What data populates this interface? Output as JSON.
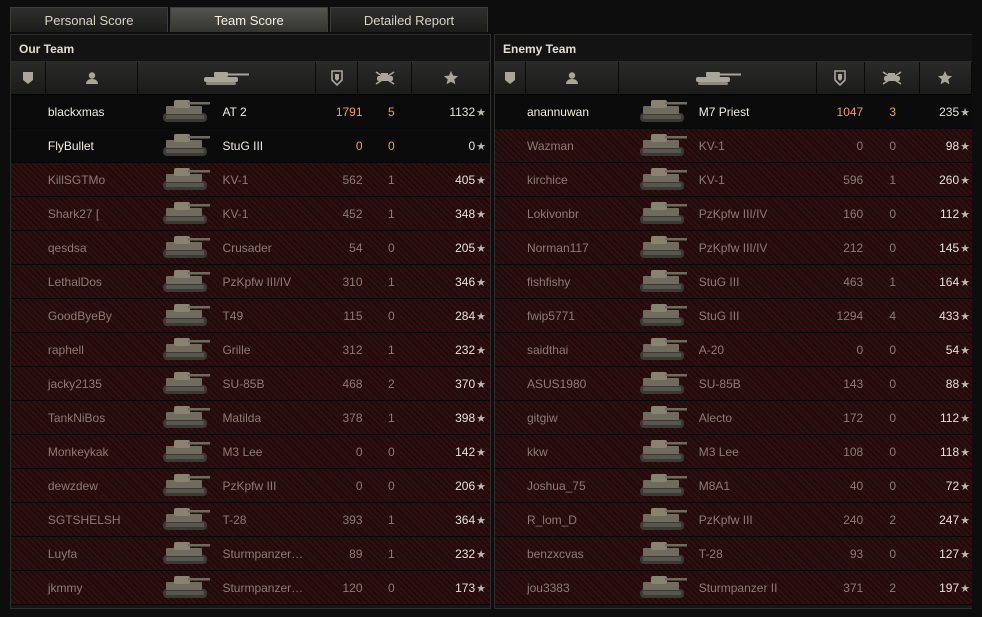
{
  "tabs": [
    {
      "label": "Personal Score",
      "active": false
    },
    {
      "label": "Team Score",
      "active": true
    },
    {
      "label": "Detailed Report",
      "active": false
    }
  ],
  "columns_icons": [
    "platoon-icon",
    "player-icon",
    "tank-icon",
    "damage-shield-icon",
    "kills-icon",
    "xp-star-icon"
  ],
  "colors": {
    "accent_orange": "#f2a13c",
    "dead_row": "#2a0c0c",
    "alive_row": "#0b0b0b"
  },
  "our_team": {
    "title": "Our Team",
    "players": [
      {
        "name": "blackxmas",
        "tank": "AT 2",
        "damage": "1791",
        "kills": "5",
        "xp": "1132",
        "alive": true
      },
      {
        "name": "FlyBullet",
        "tank": "StuG III",
        "damage": "0",
        "kills": "0",
        "xp": "0",
        "alive": true
      },
      {
        "name": "KillSGTMo",
        "tank": "KV-1",
        "damage": "562",
        "kills": "1",
        "xp": "405",
        "alive": false
      },
      {
        "name": "Shark27 [",
        "tank": "KV-1",
        "damage": "452",
        "kills": "1",
        "xp": "348",
        "alive": false
      },
      {
        "name": "qesdsa",
        "tank": "Crusader",
        "damage": "54",
        "kills": "0",
        "xp": "205",
        "alive": false
      },
      {
        "name": "LethalDos",
        "tank": "PzKpfw III/IV",
        "damage": "310",
        "kills": "1",
        "xp": "346",
        "alive": false
      },
      {
        "name": "GoodByeBy",
        "tank": "T49",
        "damage": "115",
        "kills": "0",
        "xp": "284",
        "alive": false
      },
      {
        "name": "raphell",
        "tank": "Grille",
        "damage": "312",
        "kills": "1",
        "xp": "232",
        "alive": false
      },
      {
        "name": "jacky2135",
        "tank": "SU-85B",
        "damage": "468",
        "kills": "2",
        "xp": "370",
        "alive": false
      },
      {
        "name": "TankNiBos",
        "tank": "Matilda",
        "damage": "378",
        "kills": "1",
        "xp": "398",
        "alive": false
      },
      {
        "name": "Monkeykak",
        "tank": "M3 Lee",
        "damage": "0",
        "kills": "0",
        "xp": "142",
        "alive": false
      },
      {
        "name": "dewzdew",
        "tank": "PzKpfw III",
        "damage": "0",
        "kills": "0",
        "xp": "206",
        "alive": false
      },
      {
        "name": "SGTSHELSH",
        "tank": "T-28",
        "damage": "393",
        "kills": "1",
        "xp": "364",
        "alive": false
      },
      {
        "name": "Luyfa",
        "tank": "Sturmpanzer…",
        "damage": "89",
        "kills": "1",
        "xp": "232",
        "alive": false
      },
      {
        "name": "jkmmy",
        "tank": "Sturmpanzer…",
        "damage": "120",
        "kills": "0",
        "xp": "173",
        "alive": false
      }
    ]
  },
  "enemy_team": {
    "title": "Enemy Team",
    "players": [
      {
        "name": "anannuwan",
        "tank": "M7 Priest",
        "damage": "1047",
        "kills": "3",
        "xp": "235",
        "alive": true
      },
      {
        "name": "Wazman",
        "tank": "KV-1",
        "damage": "0",
        "kills": "0",
        "xp": "98",
        "alive": false
      },
      {
        "name": "kirchice",
        "tank": "KV-1",
        "damage": "596",
        "kills": "1",
        "xp": "260",
        "alive": false
      },
      {
        "name": "Lokivonbr",
        "tank": "PzKpfw III/IV",
        "damage": "160",
        "kills": "0",
        "xp": "112",
        "alive": false
      },
      {
        "name": "Norman117",
        "tank": "PzKpfw III/IV",
        "damage": "212",
        "kills": "0",
        "xp": "145",
        "alive": false
      },
      {
        "name": "fishfishy",
        "tank": "StuG III",
        "damage": "463",
        "kills": "1",
        "xp": "164",
        "alive": false
      },
      {
        "name": "fwip5771",
        "tank": "StuG III",
        "damage": "1294",
        "kills": "4",
        "xp": "433",
        "alive": false
      },
      {
        "name": "saidthai",
        "tank": "A-20",
        "damage": "0",
        "kills": "0",
        "xp": "54",
        "alive": false
      },
      {
        "name": "ASUS1980",
        "tank": "SU-85B",
        "damage": "143",
        "kills": "0",
        "xp": "88",
        "alive": false
      },
      {
        "name": "gitgiw",
        "tank": "Alecto",
        "damage": "172",
        "kills": "0",
        "xp": "112",
        "alive": false
      },
      {
        "name": "kkw",
        "tank": "M3 Lee",
        "damage": "108",
        "kills": "0",
        "xp": "118",
        "alive": false
      },
      {
        "name": "Joshua_75",
        "tank": "M8A1",
        "damage": "40",
        "kills": "0",
        "xp": "72",
        "alive": false
      },
      {
        "name": "R_lom_D",
        "tank": "PzKpfw III",
        "damage": "240",
        "kills": "2",
        "xp": "247",
        "alive": false
      },
      {
        "name": "benzxcvas",
        "tank": "T-28",
        "damage": "93",
        "kills": "0",
        "xp": "127",
        "alive": false
      },
      {
        "name": "jou3383",
        "tank": "Sturmpanzer II",
        "damage": "371",
        "kills": "2",
        "xp": "197",
        "alive": false
      }
    ]
  }
}
